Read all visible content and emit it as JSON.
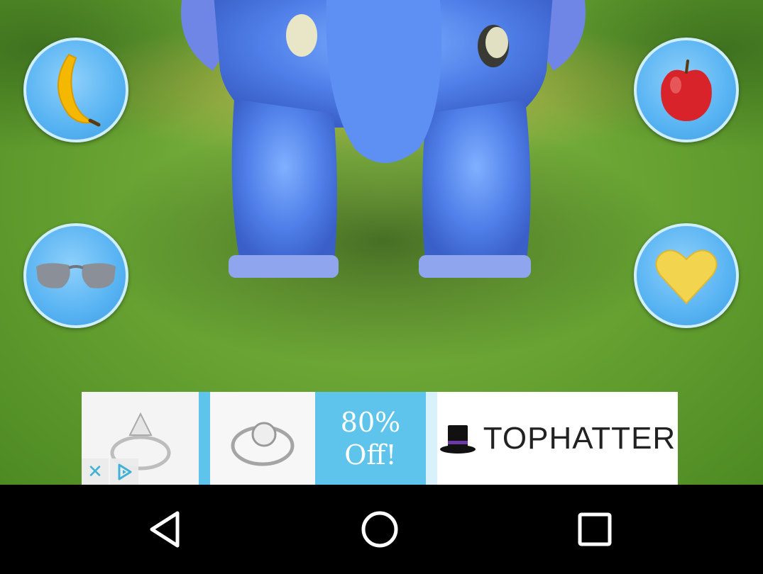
{
  "scene": {
    "character": "blue-elephant"
  },
  "action_buttons": [
    {
      "name": "banana-button",
      "icon": "banana-icon"
    },
    {
      "name": "apple-button",
      "icon": "apple-icon"
    },
    {
      "name": "sunglasses-button",
      "icon": "sunglasses-icon"
    },
    {
      "name": "heart-button",
      "icon": "heart-icon"
    }
  ],
  "ad": {
    "offer_line1": "80%",
    "offer_line2": "Off!",
    "brand": "TOPHATTER",
    "close_glyph": "✕",
    "colors": {
      "accent": "#5fc4ec"
    }
  },
  "navbar": {
    "back": "back-triangle-icon",
    "home": "home-circle-icon",
    "recents": "recents-square-icon"
  },
  "colors": {
    "button_fill": "#57b3f2",
    "button_border": "#cfeeff",
    "heart": "#f2d44e",
    "apple": "#d8232a",
    "banana": "#f5b800"
  }
}
